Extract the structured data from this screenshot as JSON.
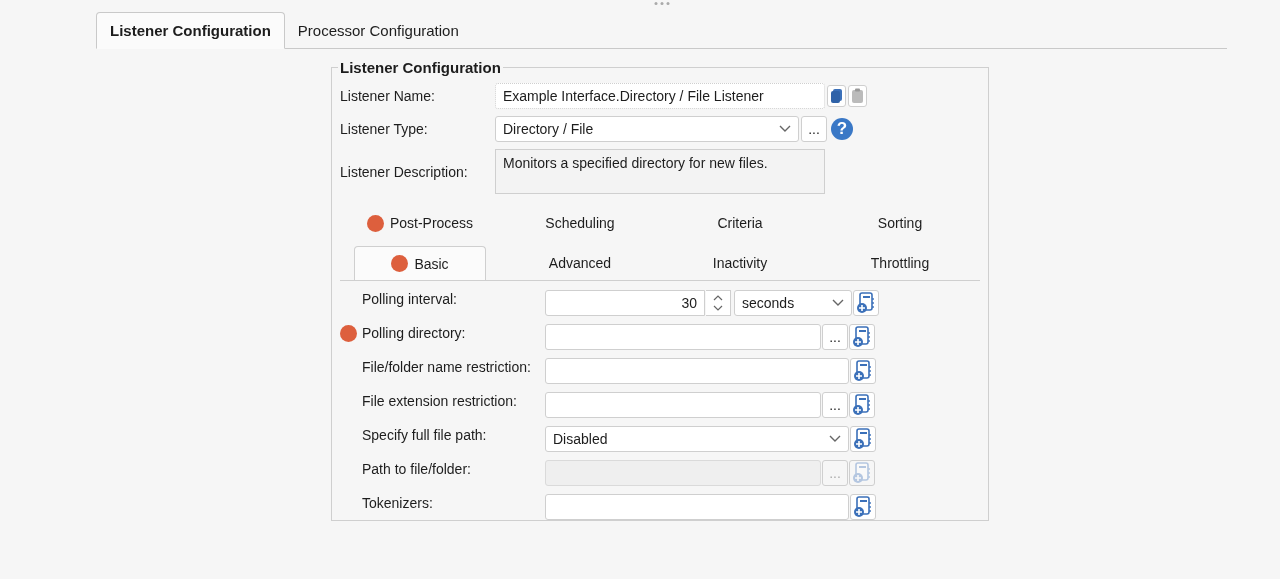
{
  "tabs": [
    {
      "label": "Listener Configuration",
      "selected": true
    },
    {
      "label": "Processor Configuration",
      "selected": false
    }
  ],
  "group": {
    "title": "Listener Configuration",
    "name": {
      "label": "Listener Name:",
      "value": "Example Interface.Directory / File Listener"
    },
    "type": {
      "label": "Listener Type:",
      "value": "Directory / File",
      "browse": "...",
      "help": "?"
    },
    "description": {
      "label": "Listener Description:",
      "value": "Monitors a specified directory for new files."
    },
    "subtab_rows": [
      [
        {
          "label": "Post-Process",
          "selected": false,
          "warning": true
        },
        {
          "label": "Scheduling",
          "selected": false,
          "warning": false
        },
        {
          "label": "Criteria",
          "selected": false,
          "warning": false
        },
        {
          "label": "Sorting",
          "selected": false,
          "warning": false
        }
      ],
      [
        {
          "label": "Basic",
          "selected": true,
          "warning": true
        },
        {
          "label": "Advanced",
          "selected": false,
          "warning": false
        },
        {
          "label": "Inactivity",
          "selected": false,
          "warning": false
        },
        {
          "label": "Throttling",
          "selected": false,
          "warning": false
        }
      ]
    ],
    "settings": [
      {
        "kind": "spinner",
        "label": "Polling interval:",
        "value": "30",
        "unit": "seconds",
        "warning": false,
        "disabled": false
      },
      {
        "kind": "browse",
        "label": "Polling directory:",
        "browse": "...",
        "warning": true,
        "disabled": false
      },
      {
        "kind": "text",
        "label": "File/folder name restriction:",
        "warning": false,
        "disabled": false
      },
      {
        "kind": "browse",
        "label": "File extension restriction:",
        "browse": "...",
        "warning": false,
        "disabled": false
      },
      {
        "kind": "select",
        "label": "Specify full file path:",
        "value": "Disabled",
        "warning": false,
        "disabled": false
      },
      {
        "kind": "browse",
        "label": "Path to file/folder:",
        "browse": "...",
        "warning": false,
        "disabled": true
      },
      {
        "kind": "text",
        "label": "Tokenizers:",
        "warning": false,
        "disabled": false
      }
    ]
  }
}
